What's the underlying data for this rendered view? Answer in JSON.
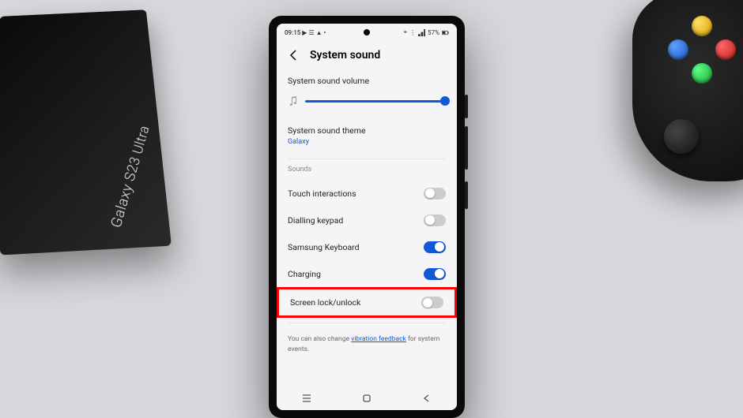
{
  "box_label": "Galaxy S23 Ultra",
  "status": {
    "time": "09:15",
    "battery": "57%"
  },
  "header": {
    "title": "System sound"
  },
  "volume": {
    "label": "System sound volume",
    "percent": 100
  },
  "theme": {
    "label": "System sound theme",
    "value": "Galaxy"
  },
  "sounds_section": "Sounds",
  "toggles": {
    "touch": {
      "label": "Touch interactions",
      "on": false
    },
    "dialing": {
      "label": "Dialling keypad",
      "on": false
    },
    "keyboard": {
      "label": "Samsung Keyboard",
      "on": true
    },
    "charging": {
      "label": "Charging",
      "on": true
    },
    "screenlock": {
      "label": "Screen lock/unlock",
      "on": false
    }
  },
  "footer": {
    "prefix": "You can also change ",
    "link": "vibration feedback",
    "suffix": " for system events."
  }
}
